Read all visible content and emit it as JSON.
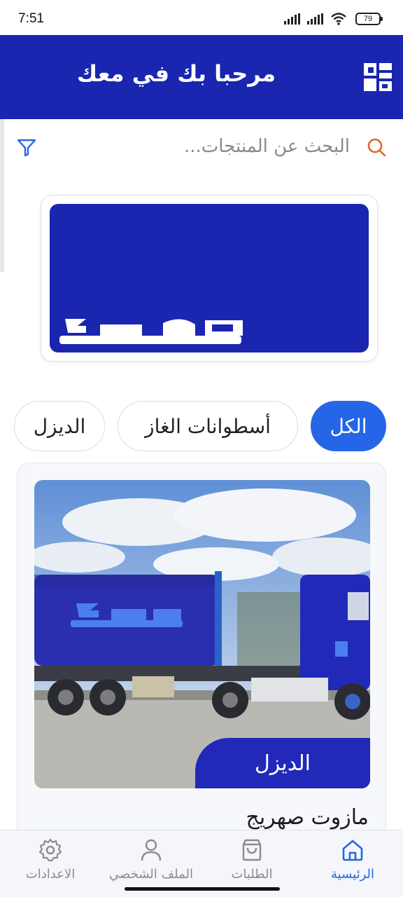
{
  "status_bar": {
    "time": "7:51",
    "battery": "79"
  },
  "header": {
    "title": "مرحبا بك في معك",
    "logo_icon": "brand-logo-icon"
  },
  "search": {
    "placeholder": "البحث عن المنتجات...",
    "search_icon": "search-icon",
    "filter_icon": "filter-icon"
  },
  "banner": {
    "logo_text": "معك"
  },
  "categories": [
    {
      "label": "الكل",
      "active": true
    },
    {
      "label": "أسطوانات الغاز",
      "active": false
    },
    {
      "label": "الديزل",
      "active": false
    }
  ],
  "product": {
    "badge": "الديزل",
    "name": "مازوت صهريج"
  },
  "bottom_nav": [
    {
      "label": "الرئيسية",
      "icon": "home-icon",
      "active": true
    },
    {
      "label": "الطلبات",
      "icon": "shopping-bag-icon",
      "active": false
    },
    {
      "label": "الملف الشخصي",
      "icon": "user-icon",
      "active": false
    },
    {
      "label": "الاعدادات",
      "icon": "gear-icon",
      "active": false
    }
  ],
  "colors": {
    "brand": "#1a25b0",
    "accent": "#2566e8",
    "search_icon": "#e0662b"
  }
}
